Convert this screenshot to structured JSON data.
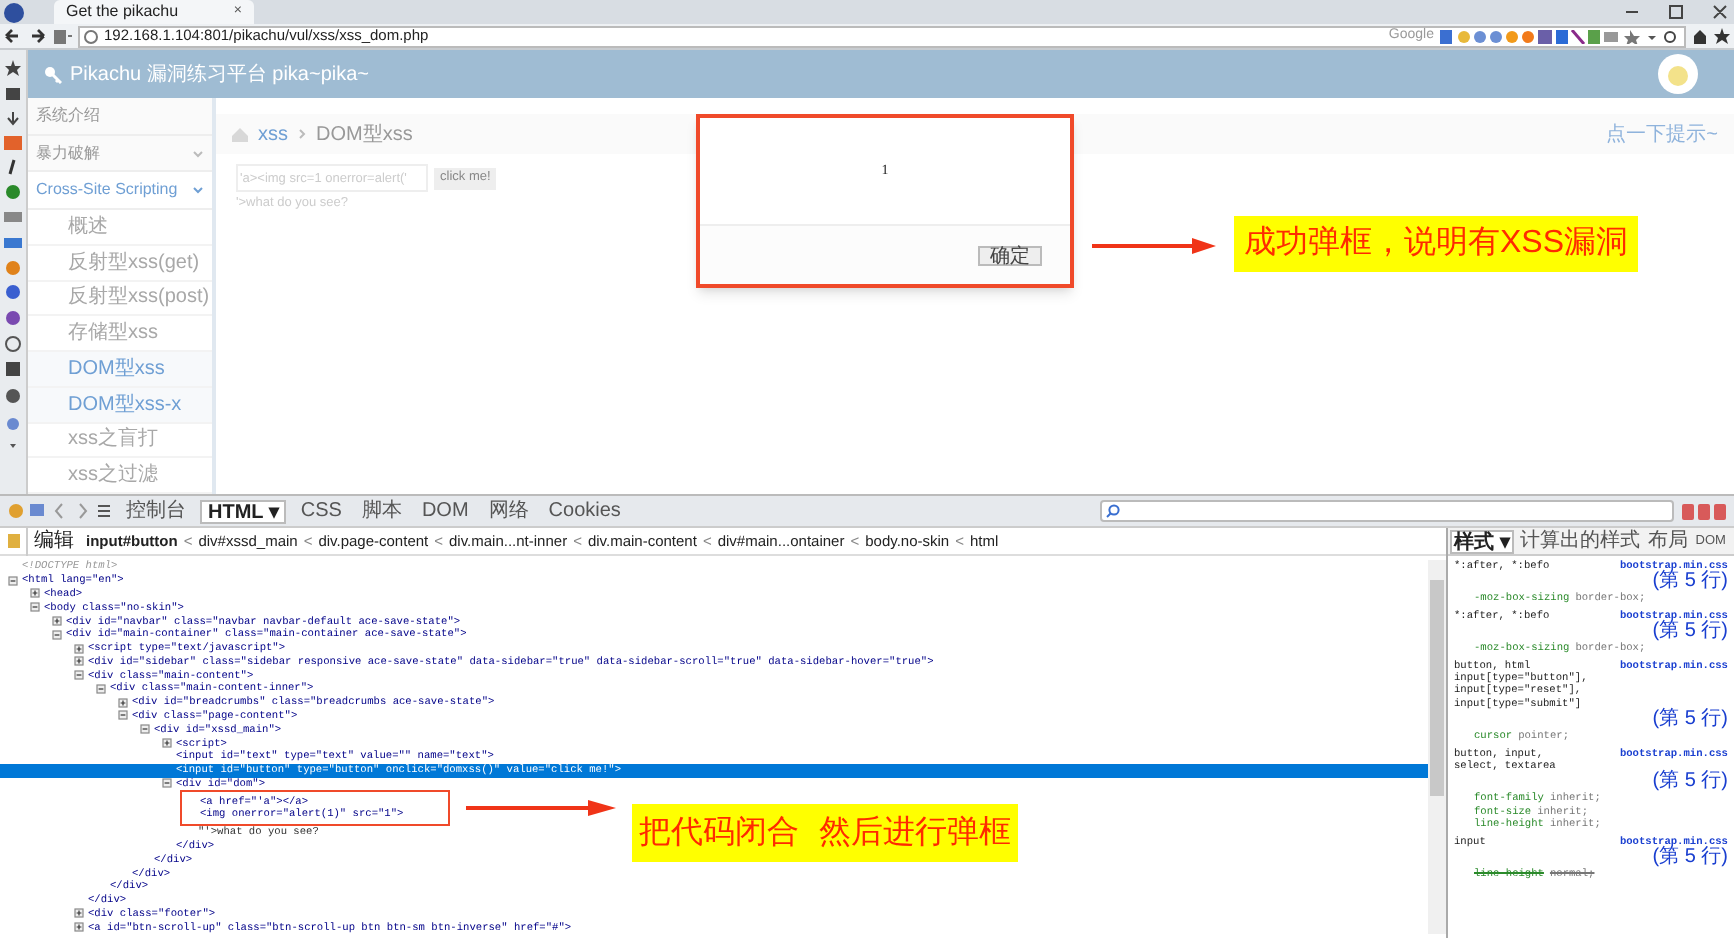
{
  "browser": {
    "tab_title": "Get the pikachu",
    "tab_close": "×",
    "address": "192.168.1.104:801/pikachu/vul/xss/xss_dom.php",
    "search_engine": "Google"
  },
  "site": {
    "title": "Pikachu 漏洞练习平台 pika~pika~",
    "sidebar": [
      {
        "label": "系统介绍",
        "selected": false
      },
      {
        "label": "暴力破解",
        "expanded": false,
        "selected": false
      },
      {
        "label": "Cross-Site Scripting",
        "expanded": true,
        "selected": true,
        "children": [
          {
            "label": "概述",
            "selected": false
          },
          {
            "label": "反射型xss(get)",
            "selected": false
          },
          {
            "label": "反射型xss(post)",
            "selected": false
          },
          {
            "label": "存储型xss",
            "selected": false
          },
          {
            "label": "DOM型xss",
            "selected": true
          },
          {
            "label": "DOM型xss-x",
            "selected": true
          },
          {
            "label": "xss之盲打",
            "selected": false
          },
          {
            "label": "xss之过滤",
            "selected": false
          }
        ]
      }
    ],
    "breadcrumb": [
      "xss",
      "DOM型xss"
    ],
    "hint_link": "点一下提示~",
    "input_value": "'a><img src=1 onerror=alert('",
    "button": "click me!",
    "output": "'>what do you see?"
  },
  "alert": {
    "message": "1",
    "ok": "确定"
  },
  "annotations": [
    {
      "text": "成功弹框，说明有XSS漏洞"
    },
    {
      "text": "把代码闭合 然后进行弹框"
    }
  ],
  "firebug": {
    "tabs": [
      {
        "label": "控制台",
        "selected": false
      },
      {
        "label": "HTML ▾",
        "selected": true
      },
      {
        "label": "CSS",
        "selected": false
      },
      {
        "label": "脚本",
        "selected": false
      },
      {
        "label": "DOM",
        "selected": false
      },
      {
        "label": "网络",
        "selected": false
      },
      {
        "label": "Cookies",
        "selected": false
      }
    ],
    "edit": "编辑",
    "path": [
      "input#button",
      "div#xssd_main",
      "div.page-content",
      "div.main...nt-inner",
      "div.main-content",
      "div#main...ontainer",
      "body.no-skin",
      "html"
    ],
    "separators": [
      "<",
      "<",
      "<",
      "<",
      "<",
      "<",
      "<"
    ],
    "tree": [
      {
        "text": "<!DOCTYPE html>",
        "kind": "doctype",
        "selected": false
      },
      {
        "text": "<html lang=\"en\">",
        "kind": "expanded",
        "selected": false,
        "children": [
          {
            "text": "<head>",
            "kind": "collapsed",
            "selected": false
          },
          {
            "text": "<body class=\"no-skin\">",
            "kind": "expanded",
            "selected": false,
            "children": [
              {
                "text": "<div id=\"navbar\" class=\"navbar navbar-default ace-save-state\">",
                "kind": "collapsed",
                "selected": false
              },
              {
                "text": "<div id=\"main-container\" class=\"main-container ace-save-state\">",
                "kind": "expanded",
                "selected": false,
                "children": [
                  {
                    "text": "<script type=\"text/javascript\">",
                    "kind": "collapsed",
                    "selected": false
                  },
                  {
                    "text": "<div id=\"sidebar\" class=\"sidebar responsive ace-save-state\" data-sidebar=\"true\" data-sidebar-scroll=\"true\" data-sidebar-hover=\"true\">",
                    "kind": "collapsed",
                    "selected": false
                  },
                  {
                    "text": "<div class=\"main-content\">",
                    "kind": "expanded",
                    "selected": false,
                    "children": [
                      {
                        "text": "<div class=\"main-content-inner\">",
                        "kind": "expanded",
                        "selected": false,
                        "children": [
                          {
                            "text": "<div id=\"breadcrumbs\" class=\"breadcrumbs ace-save-state\">",
                            "kind": "collapsed",
                            "selected": false
                          },
                          {
                            "text": "<div class=\"page-content\">",
                            "kind": "expanded",
                            "selected": false,
                            "children": [
                              {
                                "text": "<div id=\"xssd_main\">",
                                "kind": "expanded",
                                "selected": false,
                                "children": [
                                  {
                                    "text": "<script>",
                                    "kind": "collapsed",
                                    "selected": false
                                  },
                                  {
                                    "text": "<input id=\"text\" type=\"text\" value=\"\" name=\"text\">",
                                    "kind": "plain",
                                    "selected": false
                                  },
                                  {
                                    "text": "<input id=\"button\" type=\"button\" onclick=\"domxss()\" value=\"click me!\">",
                                    "kind": "plain",
                                    "selected": true
                                  },
                                  {
                                    "text": "<div id=\"dom\">",
                                    "kind": "expanded",
                                    "selected": false,
                                    "children": [
                                      {
                                        "text": "<a href=\"'a\"></a>",
                                        "kind": "plain",
                                        "selected": false,
                                        "annotated": true
                                      },
                                      {
                                        "text": "<img onerror=\"alert(1)\" src=\"1\">",
                                        "kind": "plain",
                                        "selected": false,
                                        "annotated": true
                                      },
                                      {
                                        "text": "\"'>what do you see?",
                                        "kind": "text",
                                        "selected": false,
                                        "annotated": false
                                      }
                                    ]
                                  },
                                  {
                                    "text": "</div>",
                                    "kind": "plain",
                                    "selected": false
                                  }
                                ]
                              },
                              {
                                "text": "</div>",
                                "kind": "plain",
                                "selected": false
                              }
                            ]
                          },
                          {
                            "text": "</div>",
                            "kind": "plain",
                            "selected": false
                          }
                        ]
                      },
                      {
                        "text": "</div>",
                        "kind": "plain",
                        "selected": false
                      }
                    ]
                  },
                  {
                    "text": "</div>",
                    "kind": "plain",
                    "selected": false
                  },
                  {
                    "text": "<div class=\"footer\">",
                    "kind": "collapsed",
                    "selected": false
                  },
                  {
                    "text": "<a id=\"btn-scroll-up\" class=\"btn-scroll-up btn btn-sm btn-inverse\" href=\"#\">",
                    "kind": "collapsed",
                    "selected": false
                  }
                ]
              }
            ]
          }
        ]
      }
    ],
    "side_tabs": [
      {
        "label": "样式 ▾",
        "selected": true
      },
      {
        "label": "计算出的样式",
        "selected": false
      },
      {
        "label": "布局",
        "selected": false
      },
      {
        "label": "DOM",
        "selected": false
      }
    ],
    "rules": [
      {
        "selector": [
          "*:after, *:befo"
        ],
        "source": "bootstrap.min.css",
        "line": "(第 5 行)",
        "props": [
          {
            "name": "-moz-box-sizing",
            "value": "border-box;",
            "overridden": false
          }
        ]
      },
      {
        "selector": [
          "*:after, *:befo"
        ],
        "source": "bootstrap.min.css",
        "line": "(第 5 行)",
        "props": [
          {
            "name": "-moz-box-sizing",
            "value": "border-box;",
            "overridden": false
          }
        ]
      },
      {
        "selector": [
          "button, html",
          "input[type=\"button\"],",
          "input[type=\"reset\"],",
          "input[type=\"submit\"]"
        ],
        "source": "bootstrap.min.css",
        "line": "(第 5 行)",
        "props": [
          {
            "name": "cursor",
            "value": "pointer;",
            "overridden": false
          }
        ]
      },
      {
        "selector": [
          "button, input,",
          "select, textarea"
        ],
        "source": "bootstrap.min.css",
        "line": "(第 5 行)",
        "props": [
          {
            "name": "font-family",
            "value": "inherit;",
            "overridden": false
          },
          {
            "name": "font-size",
            "value": "inherit;",
            "overridden": false
          },
          {
            "name": "line-height",
            "value": "inherit;",
            "overridden": false
          }
        ]
      },
      {
        "selector": [
          "input"
        ],
        "source": "bootstrap.min.css",
        "line": "(第 5 行)",
        "props": [
          {
            "name": "line-height",
            "value": "normal;",
            "overridden": true
          }
        ]
      }
    ]
  }
}
